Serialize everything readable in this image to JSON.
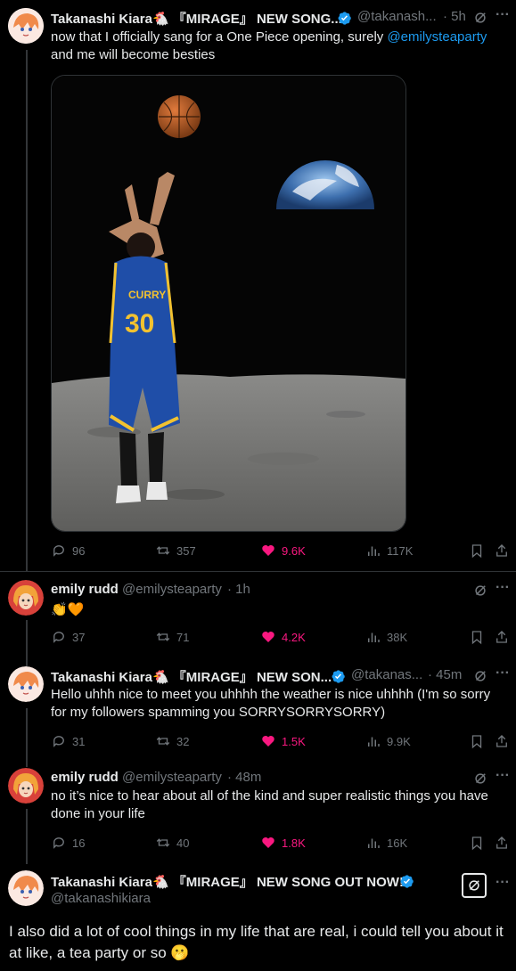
{
  "tweets": [
    {
      "name": "Takanashi Kiara🐔 『MIRAGE』 NEW SONG...",
      "handle": "@takanash...",
      "time": "· 5h",
      "text_before": "now that I officially sang for a One Piece opening, surely ",
      "mention": "@emilysteaparty",
      "text_after": " and me will become besties",
      "metrics": {
        "replies": "96",
        "reposts": "357",
        "likes": "9.6K",
        "views": "117K"
      }
    },
    {
      "name": "emily rudd",
      "handle": "@emilysteaparty",
      "time": "· 1h",
      "text": "👏🧡",
      "metrics": {
        "replies": "37",
        "reposts": "71",
        "likes": "4.2K",
        "views": "38K"
      }
    },
    {
      "name": "Takanashi Kiara🐔 『MIRAGE』 NEW SON...",
      "handle": "@takanas...",
      "time": "· 45m",
      "text": "Hello uhhh nice to meet you uhhhh the weather is nice uhhhh (I'm so sorry for my followers spamming you SORRYSORRYSORRY)",
      "metrics": {
        "replies": "31",
        "reposts": "32",
        "likes": "1.5K",
        "views": "9.9K"
      }
    },
    {
      "name": "emily rudd",
      "handle": "@emilysteaparty",
      "time": "· 48m",
      "text": "no it’s nice to hear about all of the kind and super realistic things you have done in your life",
      "metrics": {
        "replies": "16",
        "reposts": "40",
        "likes": "1.8K",
        "views": "16K"
      }
    },
    {
      "name": "Takanashi Kiara🐔 『MIRAGE』 NEW SONG OUT NOW!",
      "handle": "@takanashikiara",
      "text": "I also did a lot of cool things in my life that are real, i could tell you about it at like, a tea party or so 🫢"
    }
  ],
  "image": {
    "jersey_text": "CURRY",
    "jersey_number": "30"
  },
  "colors": {
    "accent": "#1d9bf0",
    "like": "#f91880",
    "muted": "#71767b"
  }
}
